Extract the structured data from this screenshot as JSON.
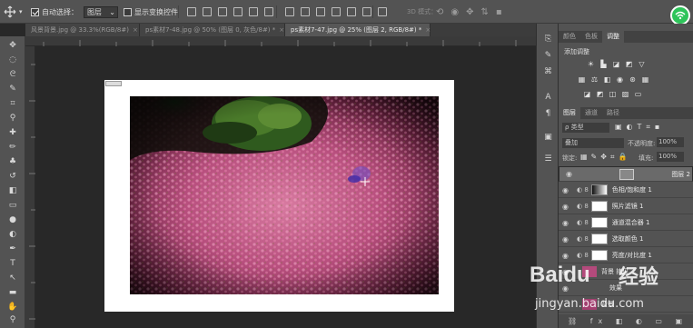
{
  "options_bar": {
    "auto_select_label": "自动选择：",
    "auto_select_value": "图层",
    "show_transform_label": "显示变换控件",
    "mode_3d_label": "3D 模式："
  },
  "tabs": [
    {
      "label": "风景背景.jpg @ 33.3%(RGB/8#)",
      "close": "×"
    },
    {
      "label": "ps素材7-48.jpg @ 50% (图层 0, 灰色/8#) *",
      "close": "×"
    },
    {
      "label": "ps素材7-47.jpg @ 25% (图层 2, RGB/8#) *",
      "close": "×"
    }
  ],
  "adjust_panel": {
    "tabs": [
      "颜色",
      "色板",
      "调整"
    ],
    "title": "添加调整"
  },
  "layers_panel": {
    "tabs": [
      "图层",
      "通道",
      "路径"
    ],
    "filter_kind": "ρ 类型",
    "blend_mode": "叠加",
    "opacity_label": "不透明度:",
    "opacity_value": "100%",
    "lock_label": "锁定:",
    "fill_label": "填充:",
    "fill_value": "100%",
    "layers": [
      {
        "name": "图层 2",
        "selected": true
      },
      {
        "name": "色相/饱和度 1",
        "selected": false
      },
      {
        "name": "照片滤镜 1",
        "selected": false
      },
      {
        "name": "通道混合器 1",
        "selected": false
      },
      {
        "name": "选取颜色 1",
        "selected": false
      },
      {
        "name": "亮度/对比度 1",
        "selected": false
      },
      {
        "name": "背景 拷贝",
        "selected": false
      },
      {
        "name": "效果",
        "selected": false
      },
      {
        "name": "背景",
        "selected": false
      }
    ]
  },
  "watermark": {
    "brand": "Baidu",
    "text": "经验",
    "url": "jingyan.baidu.com"
  },
  "colors": {
    "app_bg": "#282828",
    "panel": "#535353",
    "accent_green": "#2ec45a"
  }
}
